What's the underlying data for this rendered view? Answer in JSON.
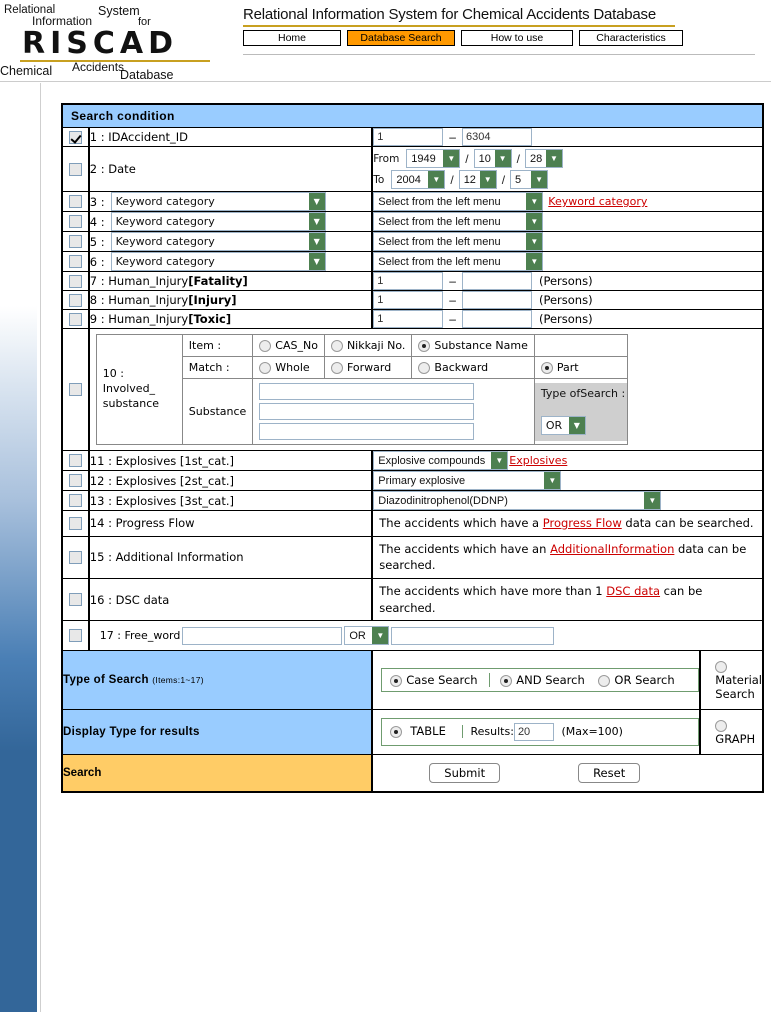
{
  "header": {
    "logo": {
      "relational": "Relational",
      "information": "Information",
      "system": "System",
      "for": "for",
      "riscad": "RISCAD",
      "accidents": "Accidents",
      "chemical": "Chemical",
      "database": "Database"
    },
    "site_title": "Relational Information System for Chemical Accidents Database",
    "nav": [
      {
        "label": "Home",
        "active": false
      },
      {
        "label": "Database Search",
        "active": true
      },
      {
        "label": "How to use",
        "active": false
      },
      {
        "label": "Characteristics",
        "active": false
      }
    ],
    "accent_color": "#ff9900",
    "rule_color": "#c8a020"
  },
  "search_panel": {
    "title": "Search condition",
    "header_bg": "#99ccff",
    "rows": {
      "r1": {
        "checked": true,
        "label": "1 : IDAccident_ID",
        "from_value": "1",
        "dash": "–",
        "to_value": "6304"
      },
      "r2": {
        "checked": false,
        "label": "2 : Date",
        "from_label": "From",
        "to_label": "To",
        "from_year": "1949",
        "from_month": "10",
        "from_day": "28",
        "to_year": "2004",
        "to_month": "12",
        "to_day": "5"
      },
      "r3": {
        "checked": false,
        "num": "3 :",
        "category": "Keyword category",
        "sub": "Select from the left menu",
        "link": "Keyword category"
      },
      "r4": {
        "checked": false,
        "num": "4 :",
        "category": "Keyword category",
        "sub": "Select from the left menu"
      },
      "r5": {
        "checked": false,
        "num": "5 :",
        "category": "Keyword category",
        "sub": "Select from the left menu"
      },
      "r6": {
        "checked": false,
        "num": "6 :",
        "category": "Keyword category",
        "sub": "Select from the left menu"
      },
      "r7": {
        "checked": false,
        "label_pre": "7 : Human_Injury",
        "label_bold": "[Fatality]",
        "from_value": "1",
        "to_value": "",
        "unit": "(Persons)"
      },
      "r8": {
        "checked": false,
        "label_pre": "8 : Human_Injury",
        "label_bold": "[Injury]",
        "from_value": "1",
        "to_value": "",
        "unit": "(Persons)"
      },
      "r9": {
        "checked": false,
        "label_pre": "9 : Human_Injury",
        "label_bold": "[Toxic]",
        "from_value": "1",
        "to_value": "",
        "unit": "(Persons)"
      },
      "r10": {
        "checked": false,
        "label": "10 : Involved_ substance",
        "item_label": "Item :",
        "match_label": "Match :",
        "substance_label": "Substance",
        "item_options": [
          {
            "label": "CAS_No",
            "selected": false
          },
          {
            "label": "Nikkaji No.",
            "selected": false
          },
          {
            "label": "Substance Name",
            "selected": true
          }
        ],
        "match_options": [
          {
            "label": "Whole",
            "selected": false
          },
          {
            "label": "Forward",
            "selected": false
          },
          {
            "label": "Backward",
            "selected": false
          },
          {
            "label": "Part",
            "selected": true
          }
        ],
        "substance_values": [
          "",
          "",
          ""
        ],
        "type_of_search_label": "Type ofSearch :",
        "type_of_search_value": "OR"
      },
      "r11": {
        "checked": false,
        "label": "11 : Explosives [1st_cat.]",
        "value": "Explosive compounds",
        "link": "Explosives"
      },
      "r12": {
        "checked": false,
        "label": "12 : Explosives [2st_cat.]",
        "value": "Primary explosive"
      },
      "r13": {
        "checked": false,
        "label": "13 : Explosives [3st_cat.]",
        "value": "Diazodinitrophenol(DDNP)"
      },
      "r14": {
        "checked": false,
        "label": "14 : Progress Flow",
        "desc_pre": "The accidents which have a ",
        "desc_link": "Progress Flow",
        "desc_post": " data can be searched."
      },
      "r15": {
        "checked": false,
        "label": "15 : Additional Information",
        "desc_pre": "The accidents which have an ",
        "desc_link": "AdditionalInformation",
        "desc_post": " data can be searched."
      },
      "r16": {
        "checked": false,
        "label": "16 : DSC data",
        "desc_pre": "The accidents which have more than 1 ",
        "desc_link": "DSC data",
        "desc_post": " can be searched."
      },
      "r17": {
        "checked": false,
        "label": "17 : Free_word",
        "word1": "",
        "operator": "OR",
        "word2": ""
      }
    },
    "type_of_search": {
      "label": "Type of Search",
      "items_note": "(Items:1~17)",
      "options": [
        {
          "label": "Case Search",
          "selected": true
        },
        {
          "label": "AND Search",
          "selected": true
        },
        {
          "label": "OR Search",
          "selected": false
        }
      ],
      "right_option": {
        "label": "Material Search",
        "selected": false
      }
    },
    "display_type": {
      "label": "Display Type for results",
      "table_option": {
        "label": "TABLE",
        "selected": true
      },
      "results_label": "Results:",
      "results_value": "20",
      "max_note": "(Max=100)",
      "right_option": {
        "label": "GRAPH",
        "selected": false
      }
    },
    "search_actions": {
      "label": "Search",
      "submit": "Submit",
      "reset": "Reset",
      "label_bg": "#ffcc66"
    }
  }
}
